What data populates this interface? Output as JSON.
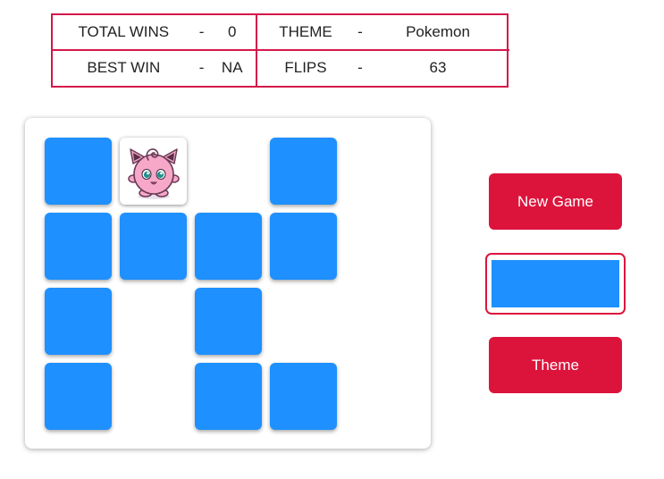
{
  "stats": {
    "total_wins": {
      "label": "TOTAL WINS",
      "sep": "-",
      "value": "0"
    },
    "best_win": {
      "label": "BEST WIN",
      "sep": "-",
      "value": "NA"
    },
    "theme": {
      "label": "THEME",
      "sep": "-",
      "value": "Pokemon"
    },
    "flips": {
      "label": "FLIPS",
      "sep": "-",
      "value": "63"
    }
  },
  "board": {
    "rows": [
      [
        "card-back",
        "jigglypuff",
        "empty",
        "card-back"
      ],
      [
        "card-back",
        "card-back",
        "card-back",
        "card-back"
      ],
      [
        "card-back",
        "empty",
        "card-back",
        "empty"
      ],
      [
        "card-back",
        "empty",
        "card-back",
        "card-back"
      ]
    ],
    "revealed_card_icon": "jigglypuff-icon",
    "card_back_color": "#1e90ff"
  },
  "controls": {
    "new_game_label": "New Game",
    "theme_label": "Theme",
    "selected_card_color": "#1e90ff"
  },
  "colors": {
    "accent": "#dc143c",
    "card_back": "#1e90ff"
  }
}
